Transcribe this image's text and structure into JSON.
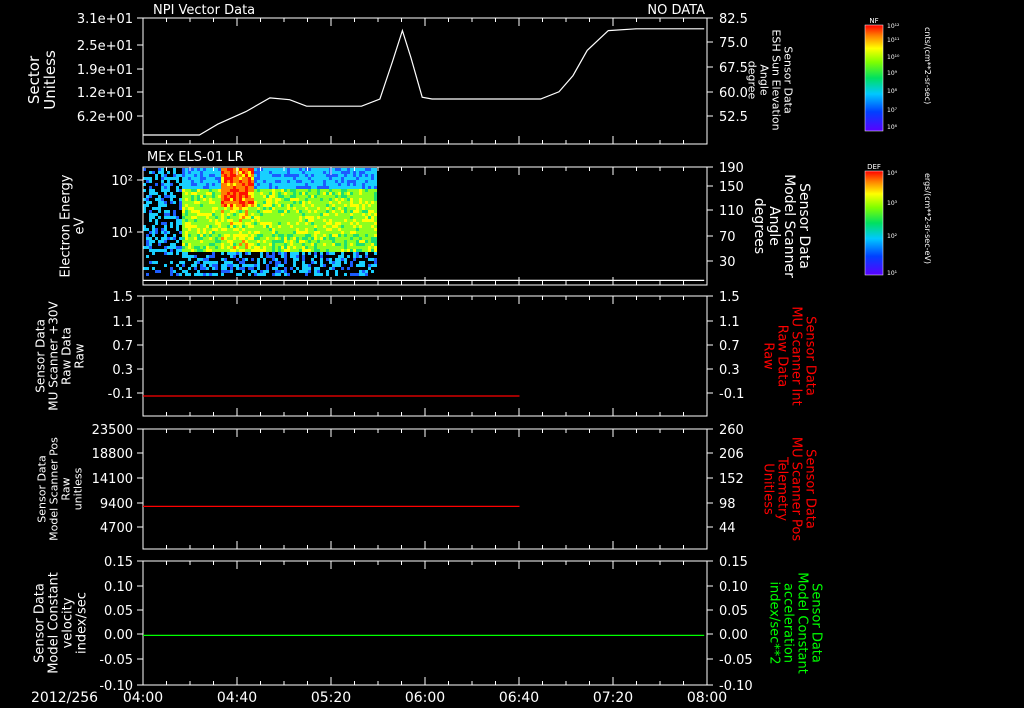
{
  "date_label": "2012/256",
  "time_ticks": [
    "04:00",
    "04:40",
    "05:20",
    "06:00",
    "06:40",
    "07:20",
    "08:00"
  ],
  "colors": {
    "background": "#000000",
    "axis": "#ffffff",
    "red": "#ff0000",
    "green": "#00ff00"
  },
  "colorbars": [
    {
      "label": "NF",
      "unit": "cnts/(cm**2-sr-sec)",
      "ticks": [
        "10¹²",
        "10¹¹",
        "10¹⁰",
        "10⁹",
        "10⁸",
        "10⁷",
        "10⁶"
      ]
    },
    {
      "label": "DEF",
      "unit": "ergs/(cm**2-sr-sec-eV)",
      "ticks": [
        "10⁴",
        "10³",
        "10²",
        "10¹"
      ]
    }
  ],
  "chart_data": [
    {
      "type": "line",
      "title_left": "NPI Vector Data",
      "title_right": "NO DATA",
      "ylabel_left": [
        "Sector",
        "Unitless"
      ],
      "yticks_left": [
        "3.1e+01",
        "2.5e+01",
        "1.9e+01",
        "1.2e+01",
        "6.2e+00"
      ],
      "ylabel_right": [
        "Sensor Data",
        "ESH Sun Elevation",
        "Angle",
        "degree"
      ],
      "yticks_right": [
        "82.5",
        "75.0",
        "67.5",
        "60.0",
        "52.5"
      ],
      "ylim": [
        48,
        83
      ],
      "series": [
        {
          "axis": "right",
          "color": "#ffffff",
          "x": [
            4.0,
            4.4,
            4.53,
            4.73,
            4.9,
            5.04,
            5.16,
            5.3,
            5.55,
            5.68,
            5.77,
            5.84,
            5.9,
            5.98,
            6.05,
            6.2,
            6.5,
            6.82,
            6.95,
            7.05,
            7.15,
            7.3,
            7.5,
            7.98
          ],
          "y": [
            50.5,
            50.5,
            53.5,
            57.0,
            60.8,
            60.3,
            58.5,
            58.5,
            58.5,
            60.5,
            71.0,
            79.5,
            72.0,
            61.0,
            60.5,
            60.5,
            60.5,
            60.5,
            62.5,
            67.0,
            74.0,
            79.5,
            80.0,
            80.0
          ]
        }
      ]
    },
    {
      "type": "heatmap",
      "title": "MEx ELS-01 LR",
      "ylabel_left": [
        "Electron Energy",
        "eV"
      ],
      "yticks_left": [
        "10²",
        "10¹"
      ],
      "ylabel_right": [
        "Sensor Data",
        "Model Scanner",
        "Angle",
        "degrees"
      ],
      "yticks_right": [
        "190",
        "150",
        "110",
        "70",
        "30"
      ],
      "ylim_right": [
        10,
        190
      ],
      "data_x_range": [
        "04:00",
        "05:48"
      ],
      "series": [
        {
          "name": "",
          "axis": "right",
          "color": "#ffffff",
          "x": [
            4.0,
            7.98
          ],
          "y": [
            17,
            17
          ]
        }
      ]
    },
    {
      "type": "line",
      "ylabel_left": [
        "Sensor Data",
        "MU Scanner +30V",
        "Raw Data",
        "Raw"
      ],
      "yticks_left": [
        "1.5",
        "1.1",
        "0.7",
        "0.3",
        "-0.1"
      ],
      "ylabel_right": [
        "Sensor Data",
        "MU Scanner Int",
        "Raw Data",
        "Raw"
      ],
      "yticks_right": [
        "1.5",
        "1.1",
        "0.7",
        "0.3",
        "-0.1"
      ],
      "ylim": [
        -0.3,
        1.5
      ],
      "series": [
        {
          "axis": "right",
          "color": "#ff0000",
          "x": [
            4.0,
            6.67
          ],
          "y": [
            0.0,
            0.0
          ]
        }
      ]
    },
    {
      "type": "line",
      "ylabel_left": [
        "Sensor Data",
        "Model Scanner Pos",
        "Raw",
        "unitless"
      ],
      "yticks_left": [
        "23500",
        "18800",
        "14100",
        "9400",
        "4700"
      ],
      "ylabel_right": [
        "Sensor Data",
        "MU Scanner Pos",
        "Telemetry",
        "Unitless"
      ],
      "yticks_right": [
        "260",
        "206",
        "152",
        "98",
        "44"
      ],
      "ylim_left": [
        0,
        23500
      ],
      "ylim_right": [
        -10,
        260
      ],
      "series": [
        {
          "axis": "left",
          "color": "#ff0000",
          "x": [
            4.0,
            6.67
          ],
          "y": [
            8350,
            8350
          ]
        }
      ]
    },
    {
      "type": "line",
      "ylabel_left": [
        "Sensor Data",
        "Model Constant",
        "velocity",
        "index/sec"
      ],
      "yticks_left": [
        "0.15",
        "0.10",
        "0.05",
        "0.00",
        "-0.05",
        "-0.10"
      ],
      "ylabel_right": [
        "Sensor Data",
        "Model Constant",
        "acceleration",
        "index/sec**2"
      ],
      "yticks_right": [
        "0.15",
        "0.10",
        "0.05",
        "0.00",
        "-0.05",
        "-0.10"
      ],
      "ylim": [
        -0.1,
        0.15
      ],
      "series": [
        {
          "axis": "left",
          "color": "#00ff00",
          "x": [
            4.0,
            7.98
          ],
          "y": [
            0.0,
            0.0
          ]
        }
      ]
    }
  ]
}
